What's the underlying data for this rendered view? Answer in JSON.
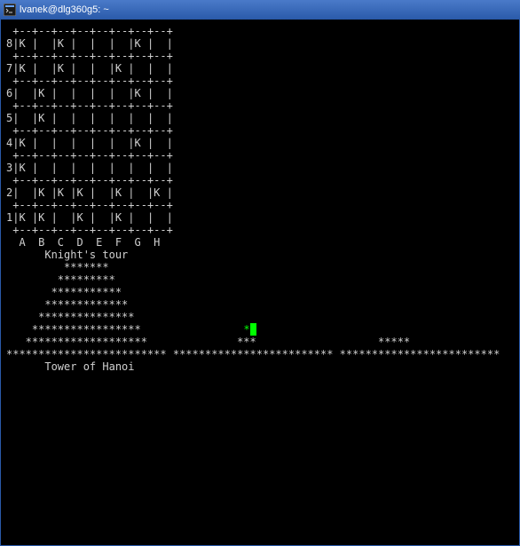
{
  "window": {
    "title": "lvanek@dlg360g5: ~",
    "icon_name": "terminal-icon"
  },
  "terminal": {
    "lines": [
      " +--+--+--+--+--+--+--+--+",
      "8|K |  |K |  |  |  |K |  |",
      " +--+--+--+--+--+--+--+--+",
      "7|K |  |K |  |  |K |  |  |",
      " +--+--+--+--+--+--+--+--+",
      "6|  |K |  |  |  |  |K |  |",
      " +--+--+--+--+--+--+--+--+",
      "5|  |K |  |  |  |  |  |  |",
      " +--+--+--+--+--+--+--+--+",
      "4|K |  |  |  |  |  |K |  |",
      " +--+--+--+--+--+--+--+--+",
      "3|K |  |  |  |  |  |  |  |",
      " +--+--+--+--+--+--+--+--+",
      "2|  |K |K |K |  |K |  |K |",
      " +--+--+--+--+--+--+--+--+",
      "1|K |K |  |K |  |K |  |  |",
      " +--+--+--+--+--+--+--+--+",
      "  A  B  C  D  E  F  G  H",
      "",
      "      Knight's tour",
      "",
      "",
      "",
      "",
      "",
      "",
      "",
      "",
      "         *******",
      "        *********",
      "       ***********",
      "      *************",
      "     ***************",
      "    *****************                *",
      "   *******************              ***                   *****",
      "************************* ************************* *************************",
      "",
      "      Tower of Hanoi"
    ],
    "cursor_line_index": 33,
    "cursor_after_char": 38
  }
}
